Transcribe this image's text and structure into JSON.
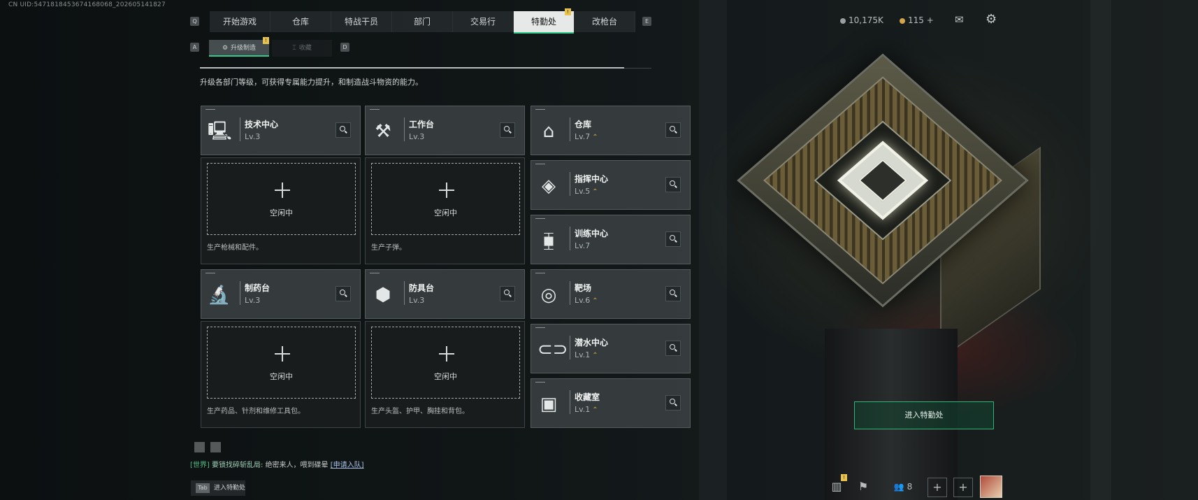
{
  "uid": "CN UID:5471818453674168068_202605141827",
  "nav": {
    "left_key": "Q",
    "right_key": "E",
    "tabs": [
      "开始游戏",
      "仓库",
      "特战干员",
      "部门",
      "交易行",
      "特勤处",
      "改枪台"
    ],
    "active_index": 5,
    "badge": "!"
  },
  "subnav": {
    "left_key": "A",
    "right_key": "D",
    "tabs": [
      "升级制造",
      "收藏"
    ],
    "active_index": 0,
    "badge": "!"
  },
  "description": "升级各部门等级，可获得专属能力提升，和制造战斗物资的能力。",
  "production_stations": [
    {
      "name": "技术中心",
      "level": "Lv.3",
      "icon": "computer-icon",
      "slot_status": "空闲中",
      "slot_desc": "生产枪械和配件。"
    },
    {
      "name": "工作台",
      "level": "Lv.3",
      "icon": "tools-icon",
      "slot_status": "空闲中",
      "slot_desc": "生产子弹。"
    },
    {
      "name": "制药台",
      "level": "Lv.3",
      "icon": "microscope-icon",
      "slot_status": "空闲中",
      "slot_desc": "生产药品、针剂和维修工具包。"
    },
    {
      "name": "防具台",
      "level": "Lv.3",
      "icon": "armor-boxes-icon",
      "slot_status": "空闲中",
      "slot_desc": "生产头盔、护甲、胸挂和背包。"
    }
  ],
  "departments": [
    {
      "name": "仓库",
      "level": "Lv.7",
      "upgradable": true,
      "icon": "warehouse-icon"
    },
    {
      "name": "指挥中心",
      "level": "Lv.5",
      "upgradable": true,
      "icon": "command-chip-icon"
    },
    {
      "name": "训练中心",
      "level": "Lv.7",
      "upgradable": false,
      "icon": "dumbbell-icon"
    },
    {
      "name": "靶场",
      "level": "Lv.6",
      "upgradable": true,
      "icon": "target-icon"
    },
    {
      "name": "潜水中心",
      "level": "Lv.1",
      "upgradable": true,
      "icon": "diving-mask-icon"
    },
    {
      "name": "收藏室",
      "level": "Lv.1",
      "upgradable": true,
      "icon": "collection-icon"
    }
  ],
  "upgrade_arrow": "⌃",
  "resources": {
    "currency": "10,175K",
    "tickets": "115",
    "plus": "+"
  },
  "enter_button": "进入特勤处",
  "chat": {
    "channel": "[世界]",
    "player": "要锁找碎斩乱局:",
    "message": "绝密来人，喂到碟晕",
    "link": "[申请入队]"
  },
  "tab_hint": {
    "key": "Tab",
    "label": "进入特勤处"
  },
  "bottom": {
    "friends_count": "8",
    "stats_badge": "!"
  },
  "colors": {
    "accent": "#33c98a",
    "upgrade": "#d2a842",
    "badge": "#e8c24a"
  }
}
